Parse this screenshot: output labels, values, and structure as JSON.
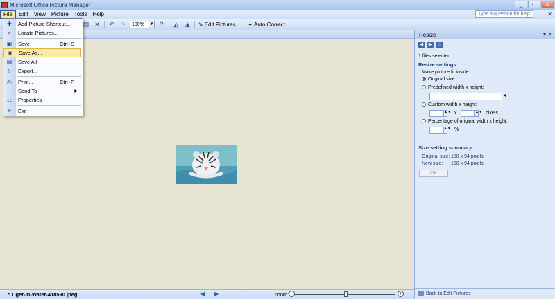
{
  "window": {
    "title": "Microsoft Office Picture Manager",
    "controls": [
      "_",
      "□",
      "✕"
    ]
  },
  "menubar": {
    "items": [
      "File",
      "Edit",
      "View",
      "Picture",
      "Tools",
      "Help"
    ],
    "help_placeholder": "Type a question for help",
    "help_close": "✕"
  },
  "toolbar": {
    "zoom_value": "100%",
    "edit_pictures": "Edit Pictures...",
    "auto_correct": "Auto Correct"
  },
  "file_menu": {
    "items": [
      {
        "label": "Add Picture Shortcut...",
        "icon": "add-shortcut-icon",
        "shortcut": ""
      },
      {
        "label": "Locate Pictures...",
        "icon": "locate-icon",
        "shortcut": ""
      },
      {
        "label": "Save",
        "icon": "save-icon",
        "shortcut": "Ctrl+S"
      },
      {
        "label": "Save As...",
        "icon": "save-as-icon",
        "shortcut": ""
      },
      {
        "label": "Save All",
        "icon": "save-all-icon",
        "shortcut": ""
      },
      {
        "label": "Export...",
        "icon": "export-icon",
        "shortcut": ""
      },
      {
        "label": "Print...",
        "icon": "print-icon",
        "shortcut": "Ctrl+P"
      },
      {
        "label": "Send To",
        "icon": "",
        "shortcut": "",
        "submenu_arrow": "▶"
      },
      {
        "label": "Properties",
        "icon": "properties-icon",
        "shortcut": ""
      },
      {
        "label": "Exit",
        "icon": "exit-icon",
        "shortcut": ""
      }
    ],
    "highlighted": "Save As..."
  },
  "status": {
    "filename": "* Tiger-in-Water-418590.jpeg",
    "zoom_label": "Zoom:",
    "zoom_level": 0.5
  },
  "taskpane": {
    "title": "Resize",
    "files_selected": "1 files selected",
    "resize_settings": "Resize settings",
    "make_fit": "Make picture fit inside:",
    "option_original": "Original size",
    "option_predefined": "Predefined width x height:",
    "option_custom": "Custom width x height:",
    "x_sep": "x",
    "pixels": "pixels",
    "option_percentage": "Percentage of original width x height:",
    "percent_sign": "%",
    "summary_title": "Size setting summary",
    "original_size_label": "Original size:",
    "original_size_value": "150 x 94 pixels",
    "new_size_label": "New size:",
    "new_size_value": "150 x 94 pixels",
    "ok_label": "OK",
    "back_link": "Back to Edit Pictures"
  },
  "colors": {
    "accent": "#1f3c7a",
    "menu_highlight": "#ffe9a6",
    "workspace_bg": "#e8e4d4"
  }
}
